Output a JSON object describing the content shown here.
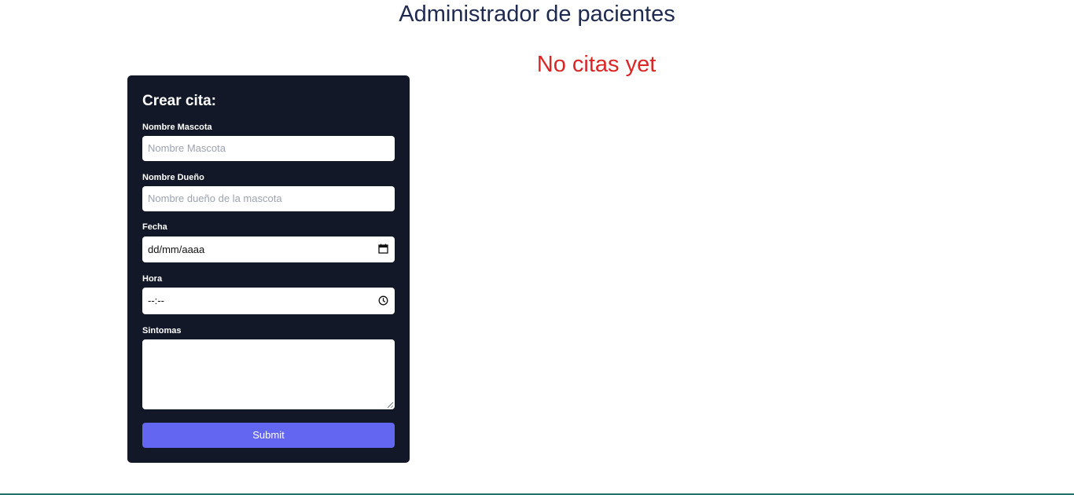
{
  "header": {
    "title": "Administrador de pacientes"
  },
  "appointments": {
    "empty_message": "No citas yet"
  },
  "form": {
    "title": "Crear cita:",
    "pet_name": {
      "label": "Nombre Mascota",
      "placeholder": "Nombre Mascota",
      "value": ""
    },
    "owner_name": {
      "label": "Nombre Dueño",
      "placeholder": "Nombre dueño de la mascota",
      "value": ""
    },
    "date": {
      "label": "Fecha",
      "display": "dd/mm/aaaa",
      "icon": "calendar-icon"
    },
    "time": {
      "label": "Hora",
      "display": "--:--",
      "icon": "clock-icon"
    },
    "symptoms": {
      "label": "Sintomas",
      "value": ""
    },
    "submit_label": "Submit"
  },
  "colors": {
    "title": "#1e2a4f",
    "empty_message": "#dc2626",
    "card_bg": "#121827",
    "button": "#6366f1"
  }
}
